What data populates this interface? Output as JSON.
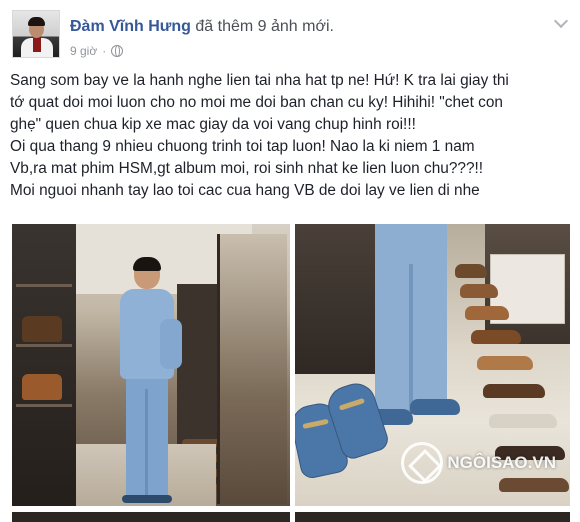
{
  "post": {
    "author": "Đàm Vĩnh Hưng",
    "action": "đã thêm 9 ảnh mới.",
    "time": "9 giờ",
    "privacy_icon": "globe-icon",
    "menu_icon": "chevron-down-icon",
    "text_lines": [
      "Sang som bay ve la hanh nghe lien tai nha hat tp ne! Hứ! K tra lai giay thi",
      "tớ quat doi moi luon cho no moi me doi ban chan cu ky! Hihihi! \"chet con",
      "ghẹ\" quen chua kip xe mac giay da voi vang chup hinh roi!!!",
      "Oi qua thang 9 nhieu chuong trinh toi tap luon! Nao la ki niem 1 nam",
      "Vb,ra mat phim HSM,gt album moi, roi sinh nhat ke lien luon chu???!!",
      "Moi nguoi nhanh tay lao toi cac cua hang VB de doi lay ve lien di nhe"
    ]
  },
  "photos": {
    "watermark": "NGÔISAO.VN",
    "count_visible": 2
  },
  "colors": {
    "author_link": "#365899",
    "meta_text": "#90949c",
    "body_text": "#1d2129"
  }
}
